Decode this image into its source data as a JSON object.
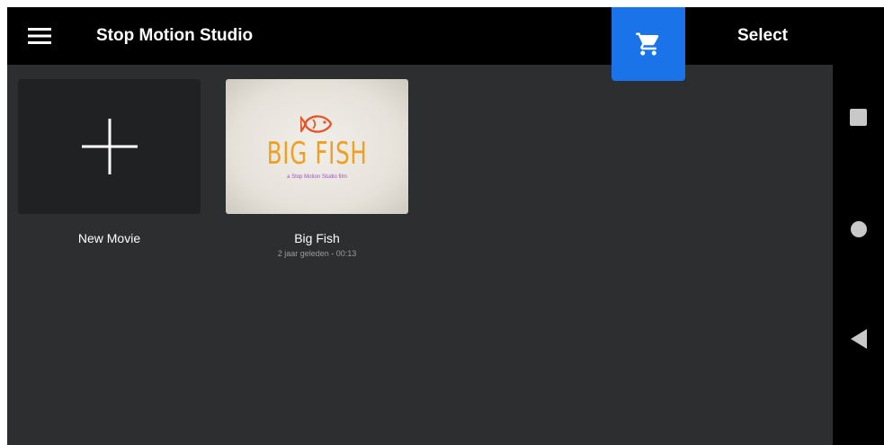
{
  "topbar": {
    "menu_icon": "hamburger-menu-icon",
    "title": "Stop Motion Studio",
    "store_icon": "shopping-cart-icon",
    "accent_color": "#1a73e8",
    "select_label": "Select"
  },
  "projects": [
    {
      "label": "New Movie",
      "icon": "plus-icon"
    },
    {
      "label": "Big Fish",
      "subtitle": "2 jaar geleden - 00:13",
      "thumbnail": {
        "logo_icon": "fish-logo-icon",
        "title": "BIG FISH",
        "tagline": "a Stop Motion Studio film",
        "title_color": "#f0a020",
        "tagline_color": "#a24fc4"
      }
    }
  ],
  "system_nav": {
    "recents_icon": "square-recents-icon",
    "home_icon": "circle-home-icon",
    "back_icon": "triangle-back-icon"
  }
}
